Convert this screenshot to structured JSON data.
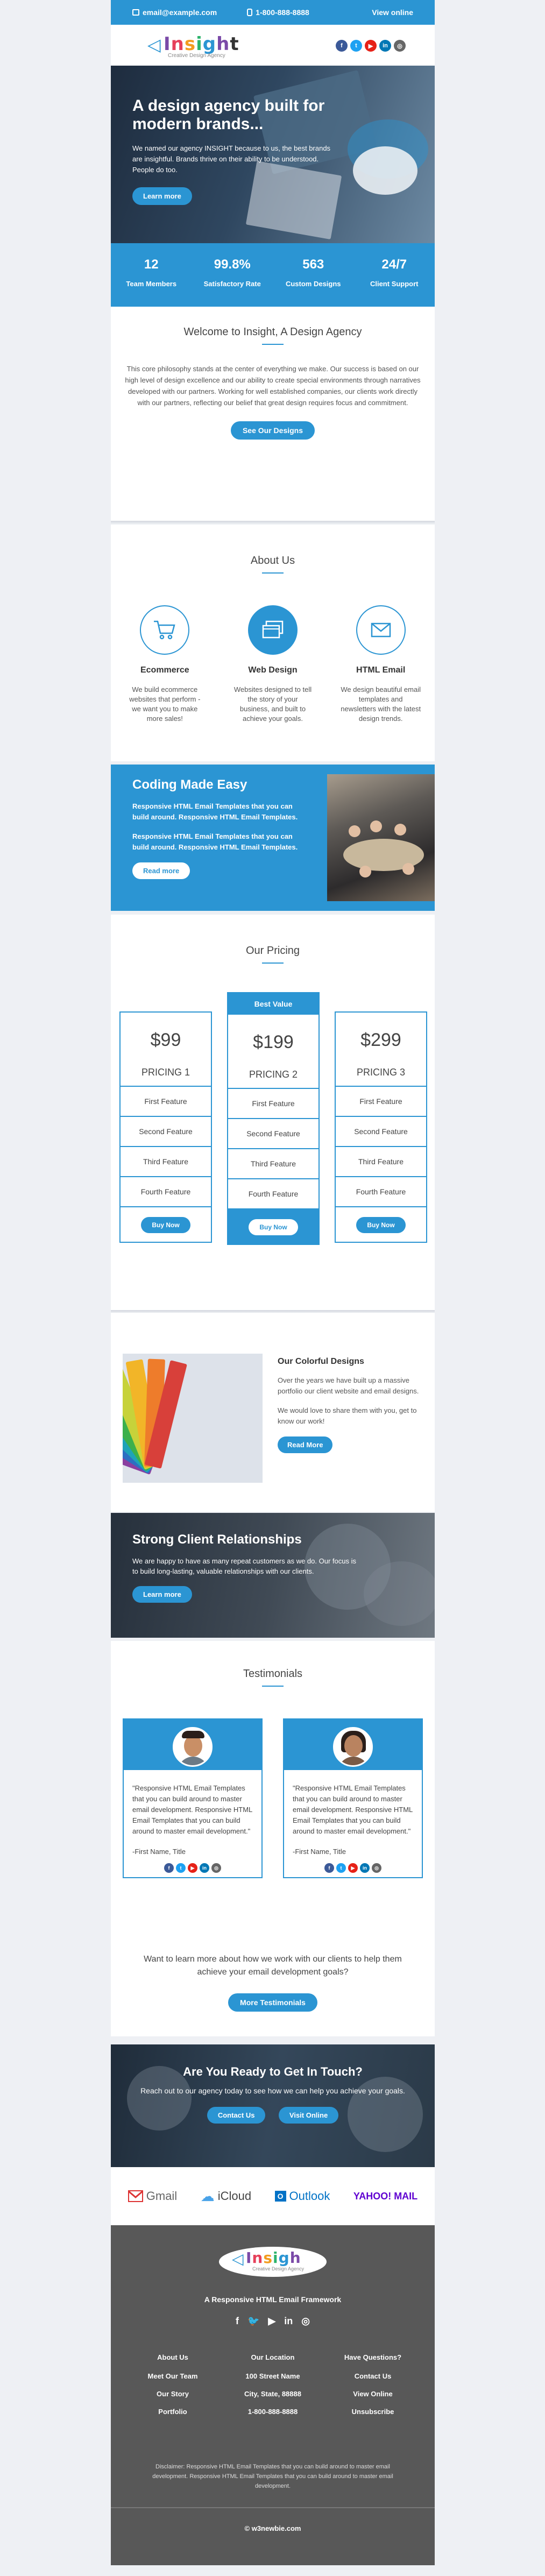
{
  "topbar": {
    "email": "email@example.com",
    "phone": "1-800-888-8888",
    "view_online": "View online"
  },
  "logo": {
    "name": "Insight",
    "tagline": "Creative Design Agency"
  },
  "social": [
    "f",
    "t",
    "▶",
    "in",
    "◎"
  ],
  "hero": {
    "title": "A design agency built for modern brands...",
    "body": "We named our agency INSIGHT because to us, the best brands are insightful. Brands thrive on their ability to be understood. People do too.",
    "button": "Learn more"
  },
  "stats": [
    {
      "value": "12",
      "label": "Team Members"
    },
    {
      "value": "99.8%",
      "label": "Satisfactory Rate"
    },
    {
      "value": "563",
      "label": "Custom Designs"
    },
    {
      "value": "24/7",
      "label": "Client Support"
    }
  ],
  "welcome": {
    "title": "Welcome to Insight, A Design Agency",
    "body": "This core philosophy stands at the center of everything we make. Our success is based on our high level of design excellence and our ability to create special environments through narratives developed with our partners. Working for well established companies, our clients work directly with our partners, reflecting our belief that great design requires focus and commitment.",
    "button": "See Our Designs"
  },
  "about": {
    "title": "About Us",
    "items": [
      {
        "name": "Ecommerce",
        "desc": "We build ecommerce websites that perform - we want you to make more sales!"
      },
      {
        "name": "Web Design",
        "desc": "Websites designed to tell the story of your business, and built to achieve your goals."
      },
      {
        "name": "HTML Email",
        "desc": "We design beautiful email templates and newsletters with the latest design trends."
      }
    ]
  },
  "coding": {
    "title": "Coding Made Easy",
    "p1": "Responsive HTML Email Templates that you can build around. Responsive HTML Email Templates.",
    "p2": "Responsive HTML Email Templates that you can build around. Responsive HTML Email Templates.",
    "button": "Read more"
  },
  "pricing": {
    "title": "Our Pricing",
    "best_label": "Best Value",
    "plans": [
      {
        "price": "$99",
        "name": "PRICING 1",
        "features": [
          "First Feature",
          "Second Feature",
          "Third Feature",
          "Fourth Feature"
        ],
        "button": "Buy Now"
      },
      {
        "price": "$199",
        "name": "PRICING 2",
        "features": [
          "First Feature",
          "Second Feature",
          "Third Feature",
          "Fourth Feature"
        ],
        "button": "Buy Now"
      },
      {
        "price": "$299",
        "name": "PRICING 3",
        "features": [
          "First Feature",
          "Second Feature",
          "Third Feature",
          "Fourth Feature"
        ],
        "button": "Buy Now"
      }
    ]
  },
  "colorful": {
    "title": "Our Colorful Designs",
    "p1": "Over the years we have built up a massive portfolio our client website and email designs.",
    "p2": "We would love to share them with you, get to know our work!",
    "button": "Read More"
  },
  "relations": {
    "title": "Strong Client Relationships",
    "body": "We are happy to have as many repeat customers as we do. Our focus is to build long-lasting, valuable relationships with our clients.",
    "button": "Learn more"
  },
  "testimonials": {
    "title": "Testimonials",
    "cards": [
      {
        "text": "\"Responsive HTML Email Templates that you can build around to master email development. Responsive HTML Email Templates that you can build around to master email development.\"",
        "name": "-First Name, Title"
      },
      {
        "text": "\"Responsive HTML Email Templates that you can build around to master email development. Responsive HTML Email Templates that you can build around to master email development.\"",
        "name": "-First Name, Title"
      }
    ],
    "want_more": "Want to learn more about how we work with our clients to help them achieve your email development goals?",
    "button": "More Testimonials"
  },
  "ready": {
    "title": "Are You Ready to Get In Touch?",
    "sub": "Reach out to our agency today to see how we can help you achieve your goals.",
    "contact": "Contact Us",
    "visit": "Visit Online"
  },
  "brands": [
    "Gmail",
    "iCloud",
    "Outlook",
    "YAHOO! MAIL"
  ],
  "footer": {
    "framework": "A Responsive HTML Email Framework",
    "cols": [
      {
        "head": "About Us",
        "items": [
          "Meet Our Team",
          "Our Story",
          "Portfolio"
        ]
      },
      {
        "head": "Our Location",
        "items": [
          "100 Street Name",
          "City, State, 88888",
          "1-800-888-8888"
        ]
      },
      {
        "head": "Have Questions?",
        "items": [
          "Contact Us",
          "View Online",
          "Unsubscribe"
        ]
      }
    ],
    "disclaimer": "Disclaimer: Responsive HTML Email Templates that you can build around to master email development. Responsive HTML Email Templates that you can build around to master email development.",
    "copyright": "© w3newbie.com"
  },
  "colors": {
    "accent": "#2b95d3",
    "footer": "#585858"
  },
  "icons": {
    "email": "email-icon",
    "phone": "phone-icon",
    "ecommerce": "cart-icon",
    "webdesign": "browser-windows-icon",
    "htmlemail": "envelope-icon"
  }
}
